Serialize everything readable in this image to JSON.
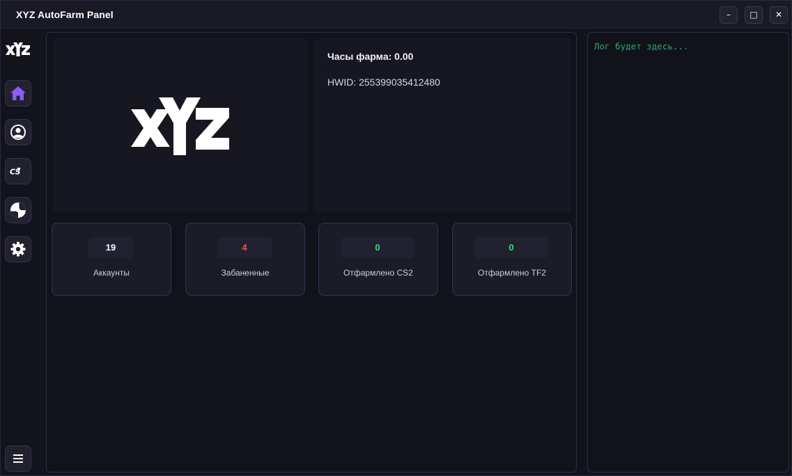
{
  "window": {
    "title": "XYZ AutoFarm Panel",
    "controls": {
      "minimize": "–",
      "maximize": "□",
      "close": "✕"
    }
  },
  "sidebar": {
    "logo_text": "XYZ",
    "items": [
      {
        "name": "home",
        "icon": "home-icon",
        "active": true
      },
      {
        "name": "accounts",
        "icon": "user-icon"
      },
      {
        "name": "cs2",
        "icon": "cs2-icon",
        "text": "CS"
      },
      {
        "name": "tf2",
        "icon": "tf2-icon"
      },
      {
        "name": "settings",
        "icon": "gear-icon"
      }
    ],
    "menu_icon": "menu-icon"
  },
  "main": {
    "logo_text": "XYZ",
    "farm_hours": "Часы фарма: 0.00",
    "hwid": "HWID: 255399035412480",
    "stats": [
      {
        "value": "19",
        "label": "Аккаунты",
        "color": "#ffffff"
      },
      {
        "value": "4",
        "label": "Забаненные",
        "color": "#ff4b4b"
      },
      {
        "value": "0",
        "label": "Отфармлено CS2",
        "color": "#2ee07a"
      },
      {
        "value": "0",
        "label": "Отфармлено TF2",
        "color": "#2ee07a"
      }
    ]
  },
  "log": {
    "placeholder": "Лог будет здесь..."
  },
  "colors": {
    "accent": "#8b5cf6",
    "log_text": "#2fa86a",
    "banned": "#ff4b4b",
    "farmed": "#2ee07a"
  }
}
